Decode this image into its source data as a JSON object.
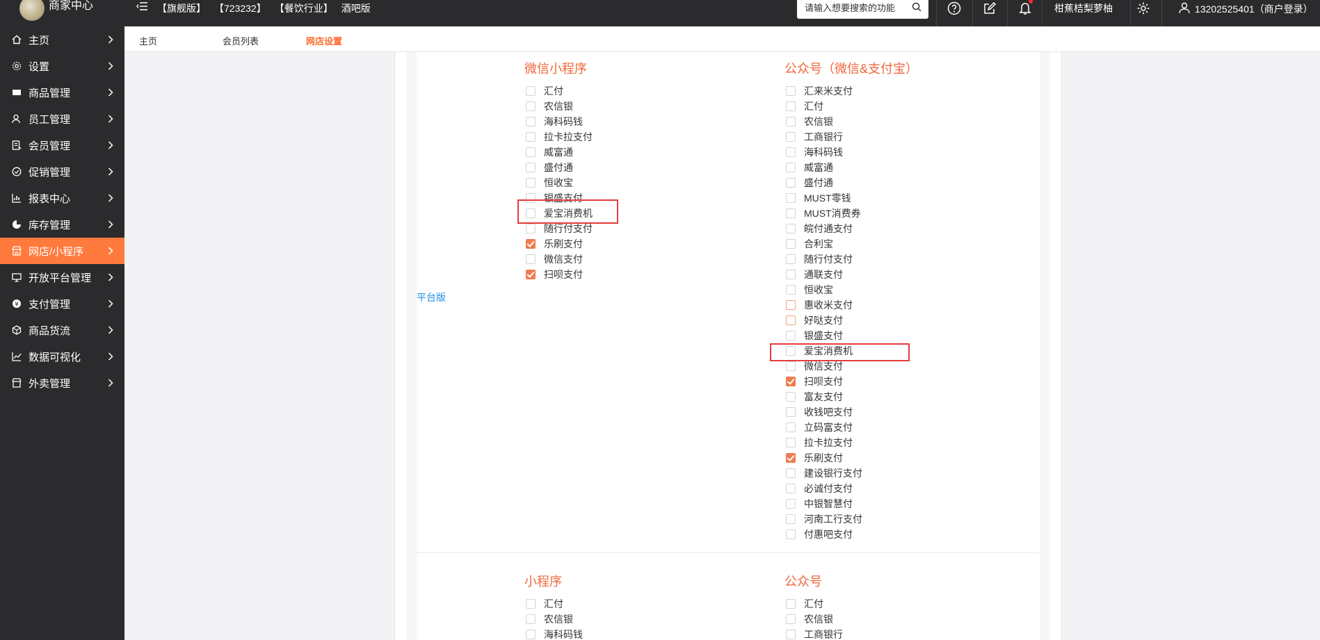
{
  "header": {
    "brand": "商家中心",
    "tags": [
      "【旗舰版】",
      "【723232】",
      "【餐饮行业】",
      "酒吧版"
    ],
    "search_placeholder": "请输入想要搜索的功能",
    "store_name": "柑蕉桔梨萝柚",
    "user": "13202525401（商户登录）"
  },
  "sidebar": {
    "items": [
      {
        "label": "主页",
        "icon": "home-icon"
      },
      {
        "label": "设置",
        "icon": "gear-icon"
      },
      {
        "label": "商品管理",
        "icon": "goods-icon"
      },
      {
        "label": "员工管理",
        "icon": "staff-icon"
      },
      {
        "label": "会员管理",
        "icon": "member-icon"
      },
      {
        "label": "促销管理",
        "icon": "promo-icon"
      },
      {
        "label": "报表中心",
        "icon": "report-icon"
      },
      {
        "label": "库存管理",
        "icon": "inventory-icon"
      },
      {
        "label": "网店/小程序",
        "icon": "shop-icon"
      },
      {
        "label": "开放平台管理",
        "icon": "monitor-icon"
      },
      {
        "label": "支付管理",
        "icon": "payment-icon"
      },
      {
        "label": "商品货流",
        "icon": "flow-icon"
      },
      {
        "label": "数据可视化",
        "icon": "chart-icon"
      },
      {
        "label": "外卖管理",
        "icon": "takeout-icon"
      }
    ],
    "active_index": 8
  },
  "tabs": [
    "主页",
    "会员列表",
    "网店设置"
  ],
  "content": {
    "platform_label": "平台版",
    "sections": {
      "mini_program": {
        "title": "微信小程序",
        "options": [
          {
            "label": "汇付",
            "checked": false
          },
          {
            "label": "农信银",
            "checked": false
          },
          {
            "label": "海科码钱",
            "checked": false
          },
          {
            "label": "拉卡拉支付",
            "checked": false
          },
          {
            "label": "威富通",
            "checked": false
          },
          {
            "label": "盛付通",
            "checked": false
          },
          {
            "label": "恒收宝",
            "checked": false
          },
          {
            "label": "银盛支付",
            "checked": false
          },
          {
            "label": "爱宝消费机",
            "checked": false
          },
          {
            "label": "随行付支付",
            "checked": false
          },
          {
            "label": "乐刷支付",
            "checked": true
          },
          {
            "label": "微信支付",
            "checked": false
          },
          {
            "label": "扫呗支付",
            "checked": true
          }
        ]
      },
      "official_account": {
        "title": "公众号（微信&支付宝）",
        "options": [
          {
            "label": "汇来米支付",
            "checked": false
          },
          {
            "label": "汇付",
            "checked": false
          },
          {
            "label": "农信银",
            "checked": false
          },
          {
            "label": "工商银行",
            "checked": false
          },
          {
            "label": "海科码钱",
            "checked": false
          },
          {
            "label": "威富通",
            "checked": false
          },
          {
            "label": "盛付通",
            "checked": false
          },
          {
            "label": "MUST零钱",
            "checked": false
          },
          {
            "label": "MUST消费券",
            "checked": false
          },
          {
            "label": "皖付通支付",
            "checked": false
          },
          {
            "label": "合利宝",
            "checked": false
          },
          {
            "label": "随行付支付",
            "checked": false
          },
          {
            "label": "通联支付",
            "checked": false
          },
          {
            "label": "恒收宝",
            "checked": false
          },
          {
            "label": "惠收米支付",
            "checked": false
          },
          {
            "label": "好哒支付",
            "checked": false
          },
          {
            "label": "银盛支付",
            "checked": false
          },
          {
            "label": "爱宝消费机",
            "checked": false
          },
          {
            "label": "微信支付",
            "checked": false
          },
          {
            "label": "扫呗支付",
            "checked": true
          },
          {
            "label": "富友支付",
            "checked": false
          },
          {
            "label": "收钱吧支付",
            "checked": false
          },
          {
            "label": "立码富支付",
            "checked": false
          },
          {
            "label": "拉卡拉支付",
            "checked": false
          },
          {
            "label": "乐刷支付",
            "checked": true
          },
          {
            "label": "建设银行支付",
            "checked": false
          },
          {
            "label": "必诚付支付",
            "checked": false
          },
          {
            "label": "中银智慧付",
            "checked": false
          },
          {
            "label": "河南工行支付",
            "checked": false
          },
          {
            "label": "付惠吧支付",
            "checked": false
          }
        ]
      },
      "small_program": {
        "title": "小程序",
        "options": [
          {
            "label": "汇付",
            "checked": false
          },
          {
            "label": "农信银",
            "checked": false
          },
          {
            "label": "海科码钱",
            "checked": false
          }
        ]
      },
      "public_account": {
        "title": "公众号",
        "options": [
          {
            "label": "汇付",
            "checked": false
          },
          {
            "label": "农信银",
            "checked": false
          },
          {
            "label": "工商银行",
            "checked": false
          }
        ]
      }
    }
  },
  "colors": {
    "accent": "#ff7a3d",
    "sidebar_bg": "#2b2b2d",
    "title": "#f0673a",
    "link": "#1f8fe6",
    "highlight": "#e83a3a"
  }
}
